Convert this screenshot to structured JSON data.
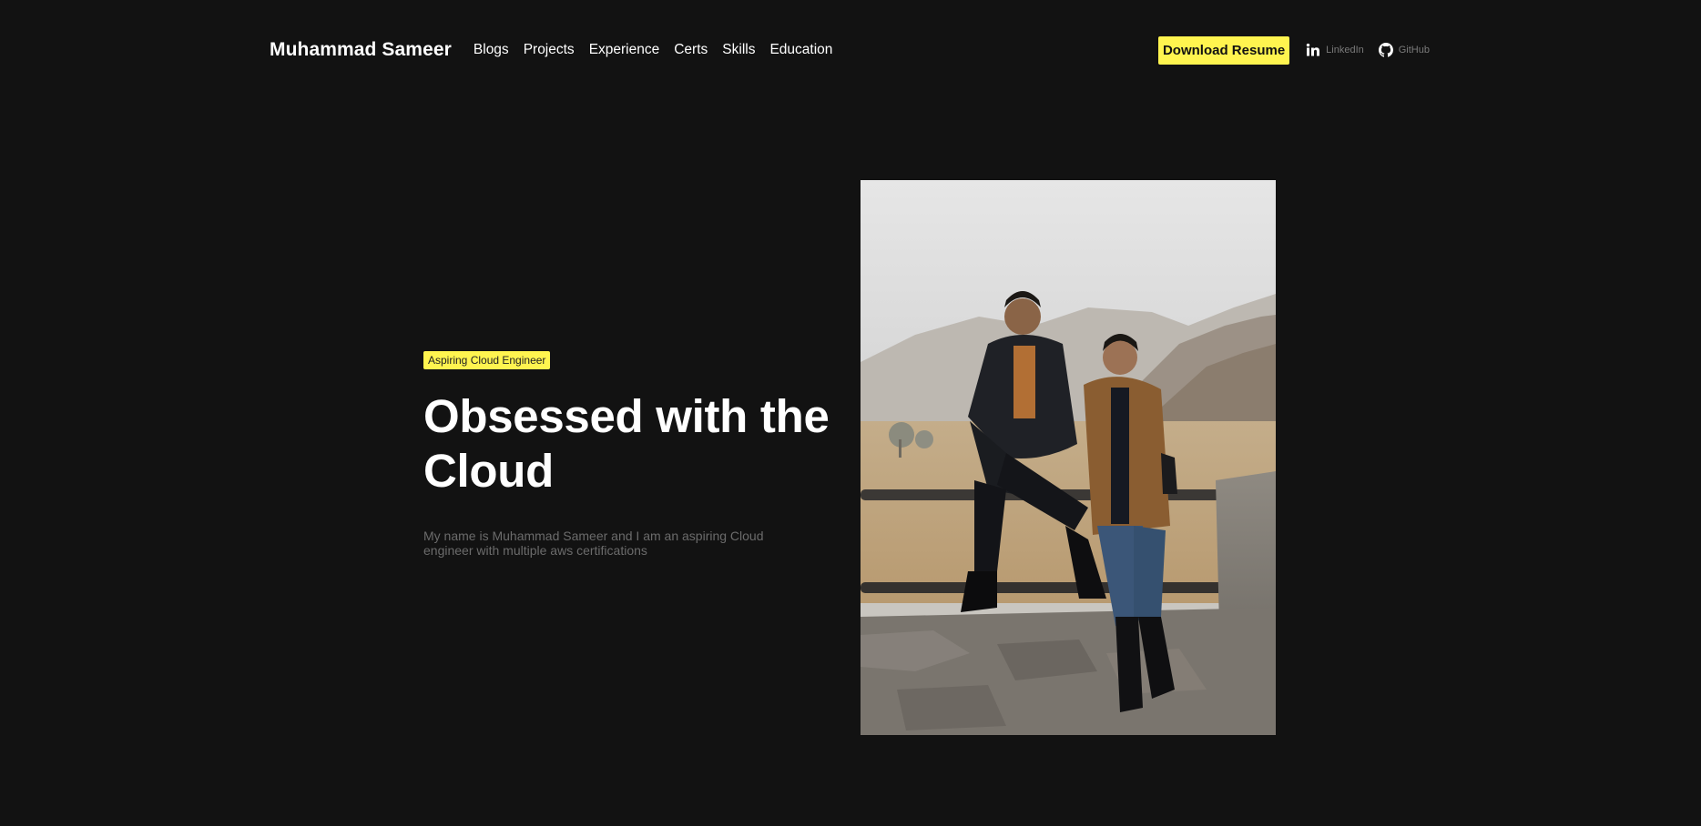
{
  "header": {
    "brand": "Muhammad Sameer",
    "nav": [
      "Blogs",
      "Projects",
      "Experience",
      "Certs",
      "Skills",
      "Education"
    ],
    "resume_button": "Download Resume",
    "linkedin": {
      "label": "LinkedIn",
      "icon": "linkedin-icon"
    },
    "github": {
      "label": "GitHub",
      "icon": "github-icon"
    }
  },
  "hero": {
    "badge": "Aspiring Cloud Engineer",
    "headline_line1": "Obsessed with the",
    "headline_line2": "Cloud",
    "intro": "My name is Muhammad Sameer and I am an aspiring Cloud engineer with multiple aws certifications"
  },
  "photo": {
    "description": "Two men posing at a wooden rail fence on a misty mountain plateau"
  },
  "colors": {
    "background": "#121212",
    "accent": "#fff44f",
    "muted_text": "#6b6b6b"
  }
}
